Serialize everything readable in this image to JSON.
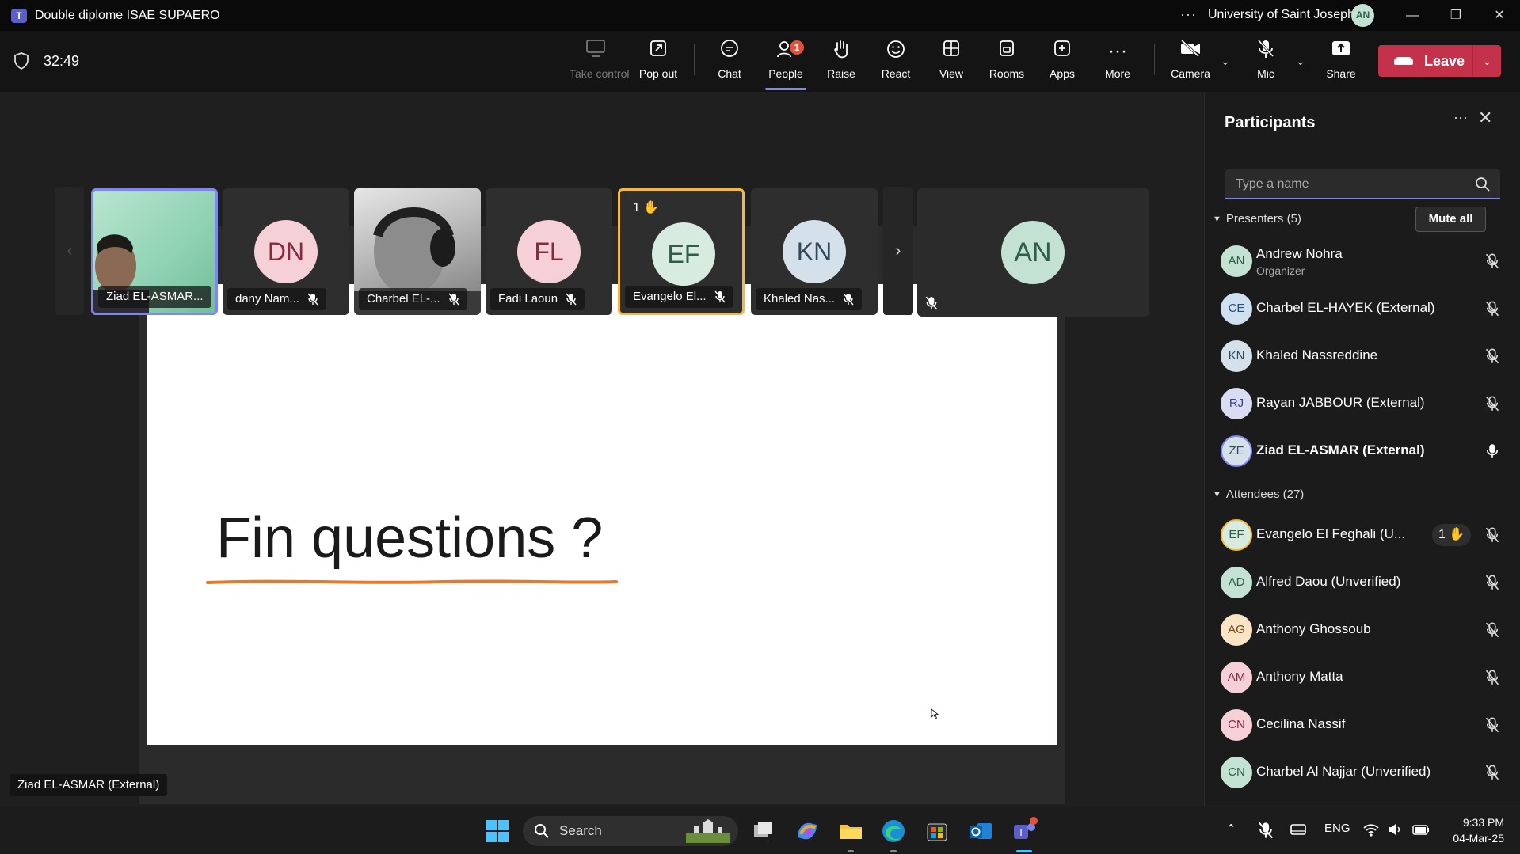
{
  "titlebar": {
    "title": "Double diplome ISAE SUPAERO",
    "org": "University of Saint Joseph",
    "org_initials": "AN",
    "more": "···",
    "minimize": "—",
    "restore": "❐",
    "close": "✕"
  },
  "toolbar": {
    "timer": "32:49",
    "buttons": [
      {
        "label": "Take control"
      },
      {
        "label": "Pop out"
      },
      {
        "label": "Chat"
      },
      {
        "label": "People",
        "badge": "1"
      },
      {
        "label": "Raise"
      },
      {
        "label": "React"
      },
      {
        "label": "View"
      },
      {
        "label": "Rooms"
      },
      {
        "label": "Apps"
      },
      {
        "label": "More"
      },
      {
        "label": "Camera"
      },
      {
        "label": "Mic"
      },
      {
        "label": "Share"
      }
    ],
    "leave_label": "Leave"
  },
  "gallery": {
    "tiles": [
      {
        "name": "Ziad EL-ASMAR..."
      },
      {
        "name": "dany Nam...",
        "initials": "DN"
      },
      {
        "name": "Charbel EL-..."
      },
      {
        "name": "Fadi Laoun",
        "initials": "FL"
      },
      {
        "name": "Evangelo El...",
        "initials": "EF",
        "hand": "1 ✋"
      },
      {
        "name": "Khaled Nas...",
        "initials": "KN"
      }
    ],
    "self_initials": "AN",
    "prev": "‹",
    "next": "›"
  },
  "slide": {
    "title": "Fin questions ?"
  },
  "presenter_label": "Ziad EL-ASMAR (External)",
  "panel": {
    "title": "Participants",
    "search_placeholder": "Type a name",
    "presenters_header": "Presenters (5)",
    "mute_all": "Mute all",
    "attendees_header": "Attendees (27)",
    "presenters": [
      {
        "initials": "AN",
        "name": "Andrew Nohra",
        "role": "Organizer",
        "color": "#c4e2d4",
        "fg": "#2c5e48"
      },
      {
        "initials": "CE",
        "name": "Charbel EL-HAYEK (External)",
        "color": "#cfe0f1",
        "fg": "#2a4f78"
      },
      {
        "initials": "KN",
        "name": "Khaled Nassreddine",
        "color": "#d5e1ea",
        "fg": "#33495a"
      },
      {
        "initials": "RJ",
        "name": "Rayan JABBOUR (External)",
        "color": "#d9dcf3",
        "fg": "#3c4289"
      },
      {
        "initials": "ZE",
        "name": "Ziad EL-ASMAR (External)",
        "color": "#d5e1ea",
        "fg": "#33495a"
      }
    ],
    "attendees": [
      {
        "initials": "EF",
        "name": "Evangelo El Feghali (U...",
        "hand": "1 ✋",
        "color": "#d7ebe0",
        "fg": "#2c5e48"
      },
      {
        "initials": "AD",
        "name": "Alfred Daou (Unverified)",
        "color": "#c4e2d4",
        "fg": "#2c5e48"
      },
      {
        "initials": "AG",
        "name": "Anthony Ghossoub",
        "color": "#fbe4c6",
        "fg": "#7a4b10"
      },
      {
        "initials": "AM",
        "name": "Anthony Matta",
        "color": "#f6d0d7",
        "fg": "#8a2a3d"
      },
      {
        "initials": "CN",
        "name": "Cecilina Nassif",
        "color": "#f6d0d7",
        "fg": "#8a2a3d"
      },
      {
        "initials": "CN",
        "name": "Charbel Al Najjar (Unverified)",
        "color": "#c4e2d4",
        "fg": "#2c5e48"
      }
    ]
  },
  "taskbar": {
    "search_label": "Search",
    "lang": "ENG",
    "time": "9:33 PM",
    "date": "04-Mar-25"
  }
}
